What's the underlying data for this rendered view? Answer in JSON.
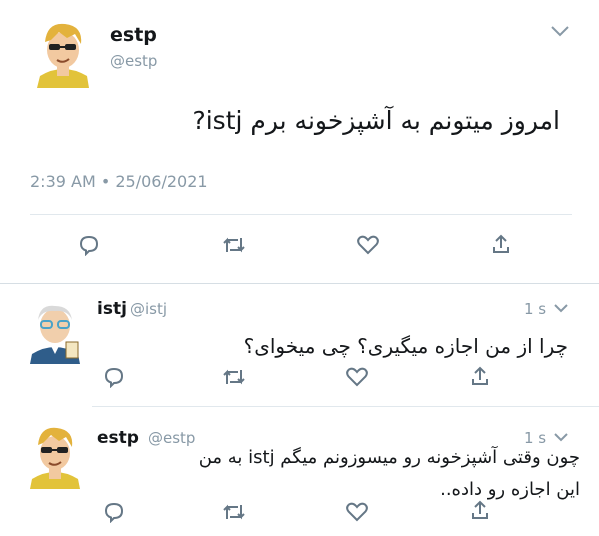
{
  "tweet": {
    "display_name": "estp",
    "handle": "@estp",
    "text": "امروز میتونم به آشپزخونه برم istj?",
    "timestamp": "2:39 AM • 25/06/2021"
  },
  "replies": [
    {
      "display_name": "istj",
      "handle": "@istj",
      "time": "1 s",
      "text": "چرا از من اجازه میگیری؟ چی میخوای؟"
    },
    {
      "display_name": "estp",
      "handle": "@estp",
      "time": "1 s",
      "text_line1": "چون وقتی آشپزخونه رو میسوزونم میگم istj به من",
      "text_line2": "این اجازه رو داده.."
    }
  ],
  "icons": [
    "chevron-down-icon",
    "reply-icon",
    "retweet-icon",
    "like-icon",
    "share-icon"
  ],
  "colors": {
    "muted": "#8899a6",
    "divider": "#e1e8ed",
    "icon": "#657786"
  }
}
